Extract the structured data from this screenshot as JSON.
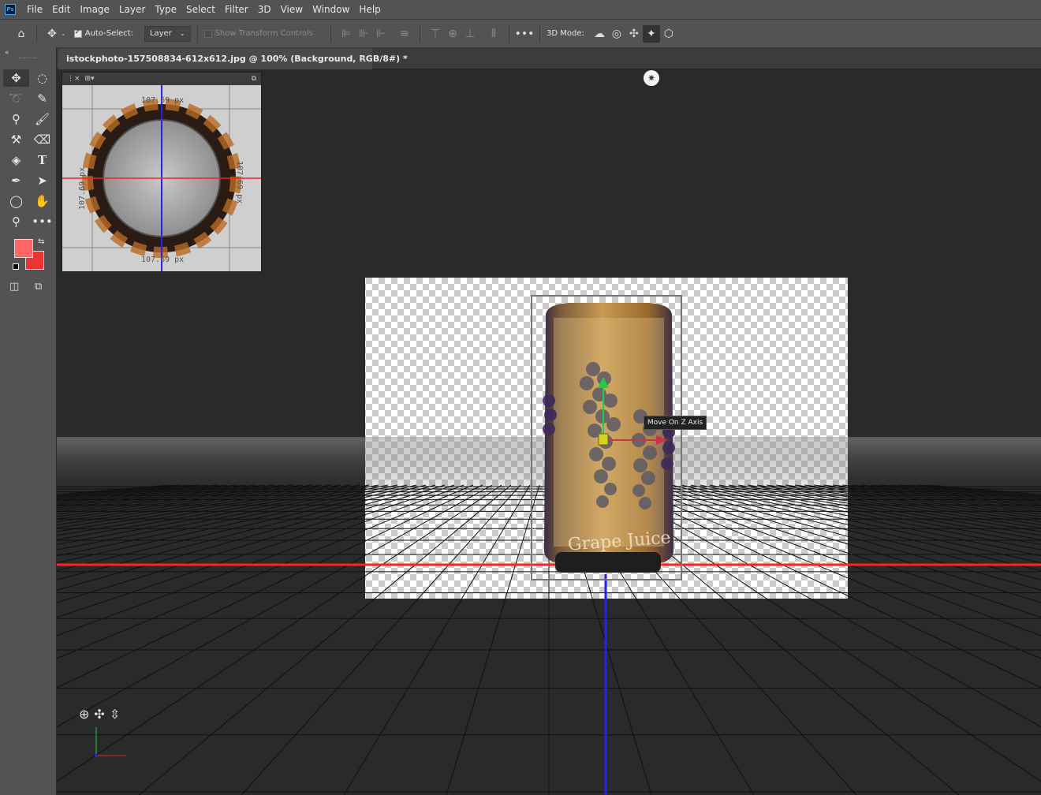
{
  "menu": [
    "File",
    "Edit",
    "Image",
    "Layer",
    "Type",
    "Select",
    "Filter",
    "3D",
    "View",
    "Window",
    "Help"
  ],
  "options": {
    "auto_select_label": "Auto-Select:",
    "layer_dropdown": "Layer",
    "show_transform": "Show Transform Controls",
    "mode_label": "3D Mode:"
  },
  "document_tab": {
    "title": "istockphoto-157508834-612x612.jpg @ 100% (Background, RGB/8#) *",
    "close": "×"
  },
  "mini_camera": {
    "dim_label": "107.69 px"
  },
  "tooltip": "Move On Z Axis",
  "can_text": "Grape Juice",
  "colors": {
    "foreground": "#ff6666",
    "background": "#ee3333",
    "x_axis": "#ff2222",
    "y_axis": "#22cc44",
    "z_axis": "#2222ee"
  }
}
